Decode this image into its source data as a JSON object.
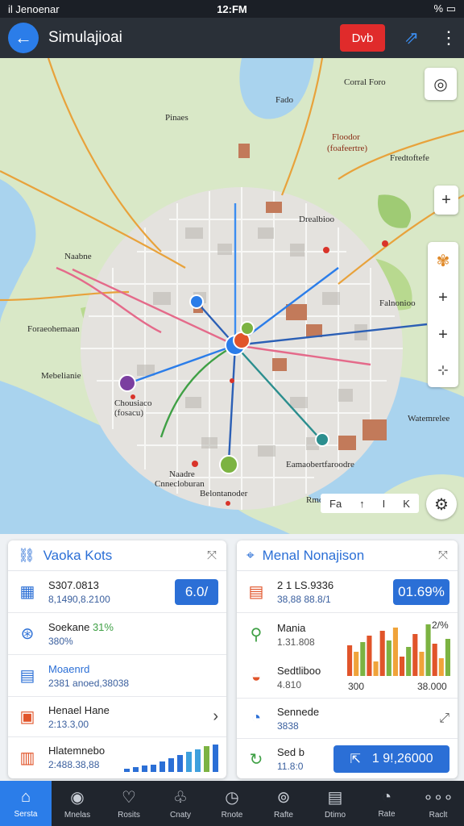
{
  "status": {
    "left": "il Jenoenar",
    "time": "12:FM",
    "right": "% "
  },
  "appbar": {
    "title": "Simulajioai",
    "record_label": "Dvb"
  },
  "map": {
    "labels": {
      "pinaes": "Pinaes",
      "fado": "Fado",
      "coral": "Corral Foro",
      "fnoodor": "Floodor",
      "fnoodor_sub": "(foafeertre)",
      "fredbafe": "Fredtoftefe",
      "drealbioo": "Drealbioo",
      "naabne": "Naabne",
      "falnonioo": "Falnonioo",
      "foraeohemaan": "Foraeohemaan",
      "mebeliante": "Mebelianie",
      "chousiaco": "Chousiaco",
      "chousiaco_sub": "(fosacu)",
      "watemrelee": "Watemrelee",
      "rmotoduna": "Rmotoduna",
      "noadre": "Naadre",
      "cnneoiburan": "Cnnecloburan",
      "eamaobertfaroodre": "Eamaobertfaroodre",
      "balonaton": "Belontanoder"
    },
    "scale": [
      "Fa",
      "↑",
      "I",
      "K"
    ]
  },
  "left_panel": {
    "title": "Vaoka Kots",
    "rows": [
      {
        "l1": "S307.0813",
        "l2": "8,1490,8.2100",
        "badge": "6.0/"
      },
      {
        "l1": "Soekane",
        "l1b": "31%",
        "l2": "380%"
      },
      {
        "l1": "Moaenrd",
        "l2": "2381 anoed,38038"
      },
      {
        "l1": "Henael Hane",
        "l2": "2:13.3,00",
        "chev": "›"
      },
      {
        "l1": "Hlatemnebo",
        "l2": "2:488.38,88"
      }
    ]
  },
  "right_panel": {
    "title": "Menal Nonajison",
    "rows": [
      {
        "l1": "2 1 LS.9336",
        "l2": "38,88 88.8/1",
        "badge": "01.69%"
      },
      {
        "l1": "Mania",
        "l2": "1.31.808",
        "pct": "2/%"
      },
      {
        "l1": "Sedtliboo",
        "l2": "4.810",
        "axis_l": "300",
        "axis_r": "38.000"
      },
      {
        "l1": "Sennede",
        "l2": "3838"
      },
      {
        "l1": "Sed b",
        "l2": "11.8:0",
        "btn": "1 9!,26000"
      }
    ],
    "chart_data": {
      "type": "bar",
      "categories": [
        "1",
        "2",
        "3",
        "4",
        "5",
        "6",
        "7",
        "8",
        "9",
        "10",
        "11",
        "12",
        "13",
        "14",
        "15",
        "16"
      ],
      "values": [
        38,
        30,
        42,
        50,
        18,
        56,
        44,
        60,
        24,
        36,
        52,
        30,
        64,
        40,
        22,
        46
      ],
      "colors": [
        "#e1542a",
        "#f0a33a",
        "#7cb342",
        "#e1542a",
        "#f0a33a",
        "#e1542a",
        "#7cb342",
        "#f0a33a",
        "#e1542a",
        "#7cb342",
        "#e1542a",
        "#f0a33a",
        "#7cb342",
        "#e1542a",
        "#f0a33a",
        "#7cb342"
      ]
    }
  },
  "left_mini_chart": {
    "chart_data": {
      "type": "bar",
      "categories": [
        "a",
        "b",
        "c",
        "d",
        "e",
        "f",
        "g",
        "h",
        "i",
        "j",
        "k"
      ],
      "values": [
        4,
        6,
        8,
        10,
        14,
        18,
        22,
        26,
        30,
        34,
        36
      ],
      "colors": [
        "#2b6fd6",
        "#2b6fd6",
        "#2b6fd6",
        "#2b6fd6",
        "#2b6fd6",
        "#2b6fd6",
        "#2b6fd6",
        "#3ea0dd",
        "#3ea0dd",
        "#7cb342",
        "#2b6fd6"
      ]
    }
  },
  "nav": [
    {
      "label": "Sersta",
      "icon": "home-icon",
      "glyph": "⌂"
    },
    {
      "label": "Mnelas",
      "icon": "map-icon",
      "glyph": "◉"
    },
    {
      "label": "Rosits",
      "icon": "pin-icon",
      "glyph": "♡"
    },
    {
      "label": "Cnaty",
      "icon": "tree-icon",
      "glyph": "♧"
    },
    {
      "label": "Rnote",
      "icon": "route-icon",
      "glyph": "◷"
    },
    {
      "label": "Rafte",
      "icon": "pin2-icon",
      "glyph": "⊚"
    },
    {
      "label": "Dtimo",
      "icon": "calendar-icon",
      "glyph": "▤"
    },
    {
      "label": "Rate",
      "icon": "compass-icon",
      "glyph": "◔"
    },
    {
      "label": "Raclt",
      "icon": "more-icon",
      "glyph": "∘∘∘"
    }
  ],
  "colors": {
    "accent": "#2b7de9",
    "record": "#e02b2b",
    "appbar": "#2a3038"
  }
}
